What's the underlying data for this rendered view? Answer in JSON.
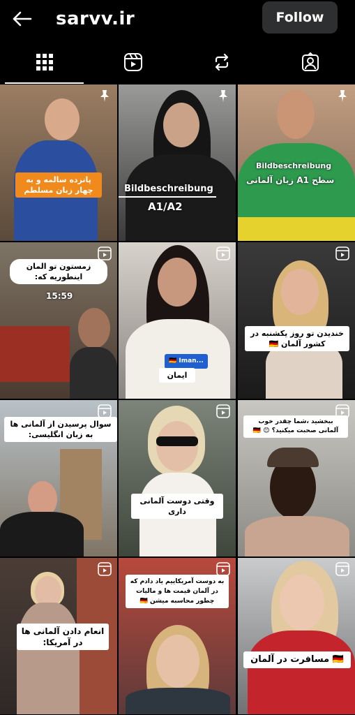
{
  "header": {
    "username": "sarvv.ir",
    "follow_label": "Follow",
    "back_icon": "arrow-left-icon"
  },
  "tabs": [
    {
      "icon": "grid-icon",
      "active": true
    },
    {
      "icon": "reels-icon",
      "active": false
    },
    {
      "icon": "repost-icon",
      "active": false
    },
    {
      "icon": "tagged-icon",
      "active": false
    }
  ],
  "posts": [
    {
      "caption": "پانزده سالمه و به چهار زبان مسلطم",
      "type": "pinned"
    },
    {
      "overlay_1": "Bildbeschreibung",
      "overlay_2": "A1/A2",
      "type": "pinned"
    },
    {
      "overlay_1": "Bildbeschreibung",
      "overlay_2": "سطح A1 زبان آلمانی",
      "type": "pinned"
    },
    {
      "caption": "زمستون تو المان اینطوریه که:",
      "time": "15:59",
      "type": "reel"
    },
    {
      "tag": "🇩🇪 Iman...",
      "caption": "ایمان",
      "type": "reel"
    },
    {
      "caption": "خندیدن تو روز یکشنبه در کشور آلمان 🇩🇪",
      "type": "reel"
    },
    {
      "caption": "سوال پرسیدن از آلمانی ها به زبان انگلیسی:",
      "type": "reel"
    },
    {
      "caption": "وقتی دوست آلمانی داری",
      "type": "reel"
    },
    {
      "caption": "ببخشید ،شما چقدر خوب آلمانی صحبت میکنید؟ 😊 🇩🇪",
      "type": "reel"
    },
    {
      "caption": "انعام دادن آلمانی ها در آمریکا:",
      "type": "reel"
    },
    {
      "caption": "به دوست آمریکاییم یاد دادم که در آلمان قیمت ها و مالیات چطور محاسبه میشن 🇩🇪",
      "type": "reel"
    },
    {
      "caption": "🇩🇪 مسافرت در آلمان",
      "type": "reel"
    }
  ],
  "colors": {
    "background": "#000000",
    "follow_button": "#2e2f31",
    "caption_orange": "#f08a1c"
  }
}
